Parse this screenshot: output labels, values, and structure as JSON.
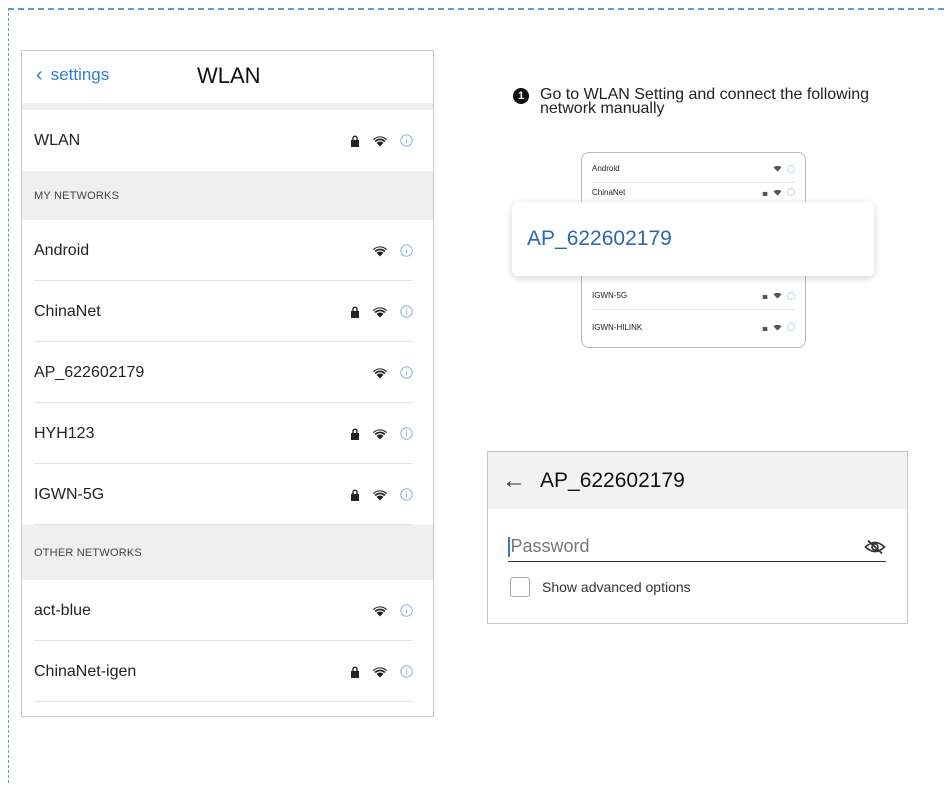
{
  "phone": {
    "back_label": "settings",
    "title": "WLAN",
    "wlan_row": "WLAN",
    "my_networks_header": "MY NETWORKS",
    "my_networks": [
      {
        "name": "Android",
        "locked": false
      },
      {
        "name": "ChinaNet",
        "locked": true
      },
      {
        "name": "AP_622602179",
        "locked": false
      },
      {
        "name": "HYH123",
        "locked": true
      },
      {
        "name": "IGWN-5G",
        "locked": true
      }
    ],
    "other_networks_header": "OTHER NETWORKS",
    "other_networks": [
      {
        "name": "act-blue",
        "locked": false
      },
      {
        "name": "ChinaNet-igen",
        "locked": true
      }
    ]
  },
  "instruction": {
    "number": "1",
    "text": "Go to WLAN Setting and connect the following network manually"
  },
  "preview": {
    "rows": [
      "Android",
      "ChinaNet",
      "IGWN-5G",
      "IGWN-HILINK"
    ],
    "highlight": "AP_622602179"
  },
  "password_dialog": {
    "title": "AP_622602179",
    "password_placeholder": "Password",
    "advanced_label": "Show advanced options"
  },
  "colors": {
    "accent": "#2f7fd0",
    "highlight_text": "#2f65b5",
    "border_dash": "#5b9bd5"
  },
  "icons": {
    "back": "chevron-left-icon",
    "lock": "lock-icon",
    "wifi": "wifi-icon",
    "info": "info-icon",
    "eye_off": "eye-off-icon",
    "arrow_back": "arrow-left-icon"
  }
}
